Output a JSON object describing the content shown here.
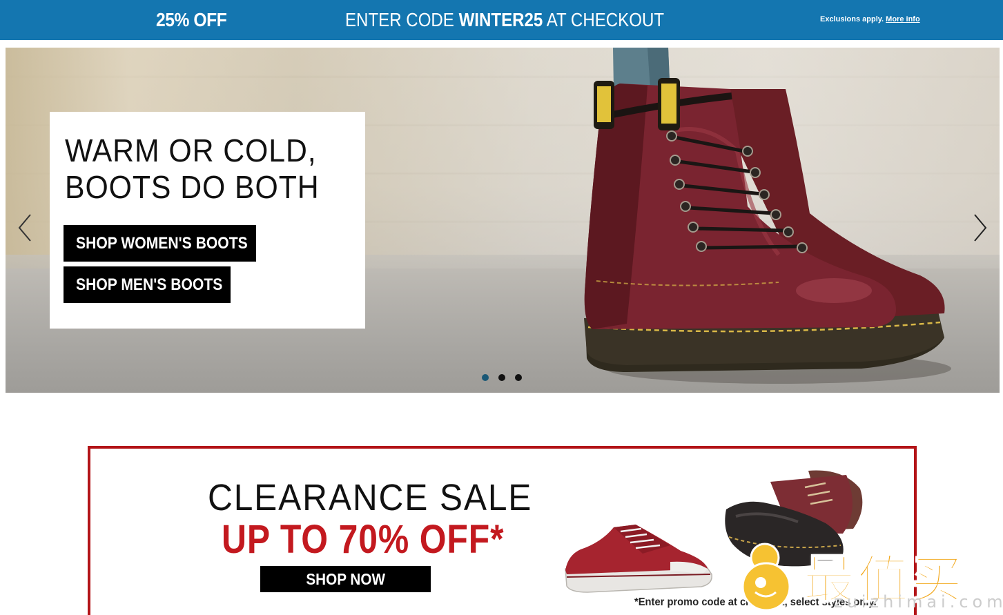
{
  "promo_bar": {
    "discount": "25% OFF",
    "code_prefix": "ENTER CODE",
    "code": "WINTER25",
    "code_suffix": "AT CHECKOUT",
    "exclusions": "Exclusions apply.",
    "more_info": "More info",
    "background_color": "#1476b0"
  },
  "hero": {
    "title": "WARM OR COLD,\nBOOTS DO BOTH",
    "buttons": {
      "women": "SHOP WOMEN'S BOOTS",
      "men": "SHOP MEN'S BOOTS"
    },
    "prev_icon": "chevron-left-icon",
    "next_icon": "chevron-right-icon",
    "slide_count": 3,
    "active_slide": 1,
    "active_dot_color": "#1a5876"
  },
  "clearance": {
    "title": "CLEARANCE SALE",
    "subtitle": "UP TO 70% OFF*",
    "button": "SHOP NOW",
    "note": "*Enter promo code at checkout, select styles only.",
    "border_color": "#b31418",
    "accent_color": "#c3191f"
  },
  "watermark": {
    "text": "最值买",
    "url": "zuizhimai.com",
    "color": "#f2a81d"
  }
}
